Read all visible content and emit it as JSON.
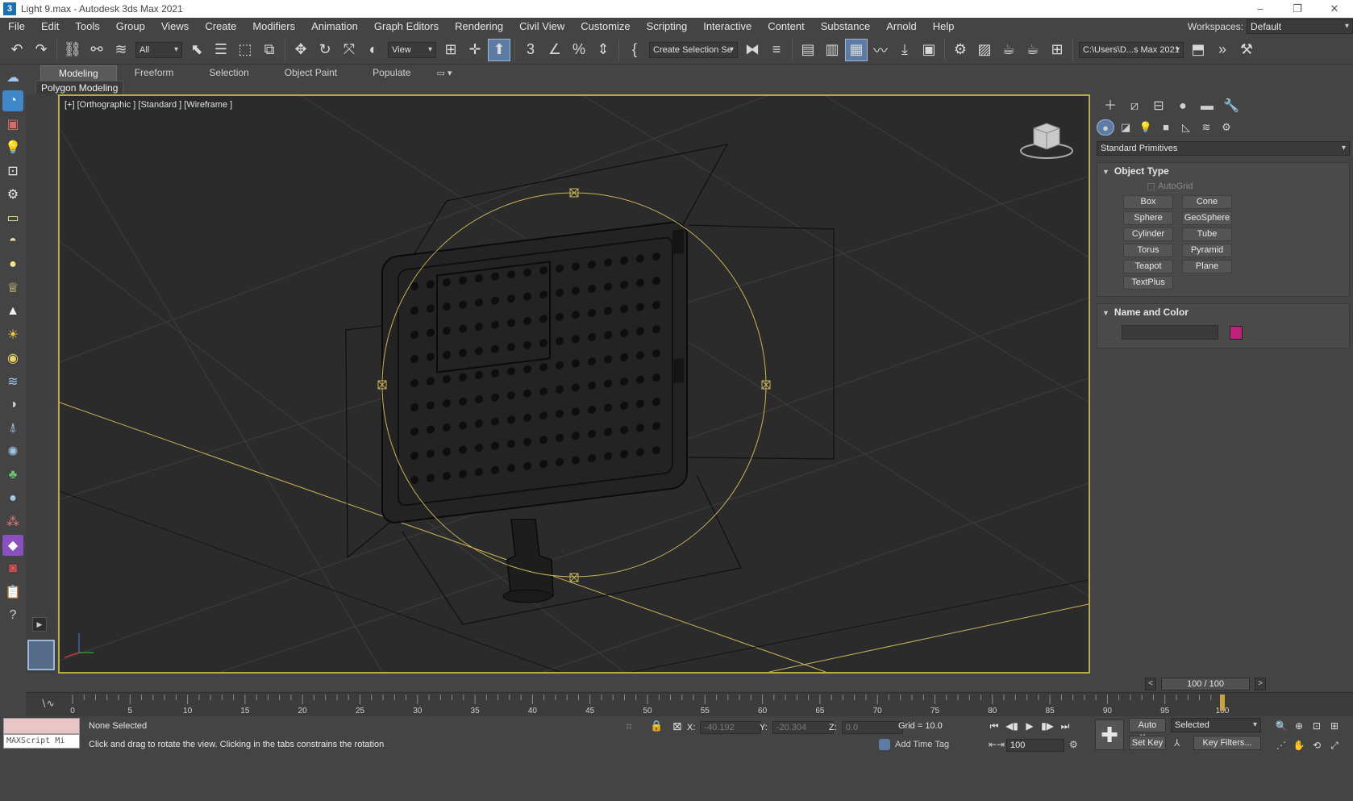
{
  "window": {
    "app_icon": "3",
    "title": "Light 9.max - Autodesk 3ds Max 2021",
    "controls": [
      "–",
      "❐",
      "✕"
    ]
  },
  "menu": {
    "items": [
      "File",
      "Edit",
      "Tools",
      "Group",
      "Views",
      "Create",
      "Modifiers",
      "Animation",
      "Graph Editors",
      "Rendering",
      "Civil View",
      "Customize",
      "Scripting",
      "Interactive",
      "Content",
      "Substance",
      "Arnold",
      "Help"
    ],
    "workspaces_label": "Workspaces:",
    "workspaces_value": "Default"
  },
  "toolbar": {
    "selection_filter": "All",
    "ref_coord": "View",
    "named_selection": "Create Selection Se",
    "project_path": "C:\\Users\\D...s Max 2021"
  },
  "ribbon": {
    "tabs": [
      "Modeling",
      "Freeform",
      "Selection",
      "Object Paint",
      "Populate"
    ],
    "active_tab": "Modeling",
    "panel_label": "Polygon Modeling"
  },
  "viewport": {
    "label": "[+] [Orthographic ] [Standard ] [Wireframe ]",
    "border_color": "#b9a94a",
    "background": "#2b2b2b",
    "light_color": "#c9b455"
  },
  "command_panel": {
    "category": "Standard Primitives",
    "object_type_title": "Object Type",
    "autogrid_label": "AutoGrid",
    "buttons": [
      "Box",
      "Cone",
      "Sphere",
      "GeoSphere",
      "Cylinder",
      "Tube",
      "Torus",
      "Pyramid",
      "Teapot",
      "Plane",
      "TextPlus"
    ],
    "name_color_title": "Name and Color",
    "swatch_color": "#c0207a"
  },
  "time_slider": {
    "value": "100 / 100",
    "prev": "<",
    "next": ">"
  },
  "trackbar": {
    "ticks": [
      "0",
      "5",
      "10",
      "15",
      "20",
      "25",
      "30",
      "35",
      "40",
      "45",
      "50",
      "55",
      "60",
      "65",
      "70",
      "75",
      "80",
      "85",
      "90",
      "95",
      "100"
    ]
  },
  "status": {
    "maxscript_label": "MAXScript Mi",
    "selection": "None Selected",
    "hint": "Click and drag to rotate the view.  Clicking in the tabs constrains the rotation",
    "x_label": "X:",
    "x_value": "-40.192",
    "y_label": "Y:",
    "y_value": "-20.304",
    "z_label": "Z:",
    "z_value": "0.0",
    "grid": "Grid = 10.0",
    "add_time_tag": "Add Time Tag",
    "frame": "100",
    "auto_key": "Auto Key",
    "set_key": "Set Key",
    "selected": "Selected",
    "key_filters": "Key Filters..."
  }
}
